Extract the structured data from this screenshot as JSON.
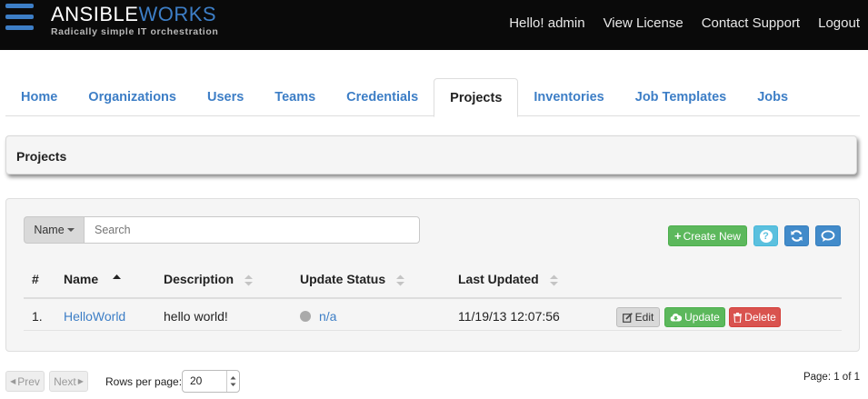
{
  "navbar": {
    "brand_part1": "ANSIBLE",
    "brand_part2": "WORKS",
    "tagline": "Radically simple IT orchestration",
    "links": [
      "Hello! admin",
      "View License",
      "Contact Support",
      "Logout"
    ]
  },
  "tabs": [
    "Home",
    "Organizations",
    "Users",
    "Teams",
    "Credentials",
    "Projects",
    "Inventories",
    "Job Templates",
    "Jobs"
  ],
  "active_tab": "Projects",
  "section_title": "Projects",
  "search": {
    "field_label": "Name",
    "placeholder": "Search"
  },
  "toolbar": {
    "create_label": "Create New",
    "help_icon": "question-circle-icon",
    "refresh_icon": "refresh-icon",
    "chat_icon": "chat-icon"
  },
  "table": {
    "columns": [
      "#",
      "Name",
      "Description",
      "Update Status",
      "Last Updated"
    ],
    "rows": [
      {
        "index": "1.",
        "name": "HelloWorld",
        "description": "hello world!",
        "status": "n/a",
        "last_updated": "11/19/13 12:07:56",
        "actions": [
          "Edit",
          "Update",
          "Delete"
        ]
      }
    ]
  },
  "pagination": {
    "prev": "Prev",
    "next": "Next",
    "rows_label": "Rows per page:",
    "rows_value": "20",
    "page_info": "Page: 1 of 1"
  },
  "colors": {
    "navbar_bg": "#0a0a0a",
    "brand_blue": "#3d7ec6",
    "success": "#5cb85c",
    "info": "#5bc0de",
    "primary": "#428bca",
    "danger": "#d9534f"
  }
}
